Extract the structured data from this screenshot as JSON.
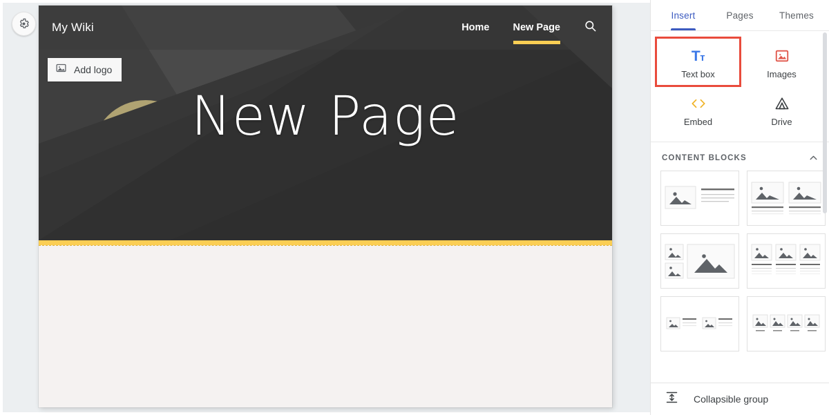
{
  "editor": {
    "settings_button": "settings-gear",
    "site": {
      "title": "My Wiki",
      "add_logo_label": "Add logo",
      "banner_heading": "New Page",
      "nav": [
        {
          "label": "Home",
          "active": false
        },
        {
          "label": "New Page",
          "active": true
        }
      ],
      "search_label": "Search",
      "accent_color": "#fbce54",
      "banner_bg": "#333333",
      "body_bg": "#f5f2f1"
    }
  },
  "panel": {
    "tabs": [
      {
        "label": "Insert",
        "active": true
      },
      {
        "label": "Pages",
        "active": false
      },
      {
        "label": "Themes",
        "active": false
      }
    ],
    "active_tab_color": "#3c5bc0",
    "highlight_color": "#e94b3c",
    "insert_items": [
      {
        "label": "Text box",
        "icon": "text-box-icon",
        "highlighted": true,
        "color": "#3b78e7"
      },
      {
        "label": "Images",
        "icon": "images-icon",
        "highlighted": false,
        "color": "#e0564a"
      },
      {
        "label": "Embed",
        "icon": "embed-code-icon",
        "highlighted": false,
        "color": "#f0b429"
      },
      {
        "label": "Drive",
        "icon": "google-drive-icon",
        "highlighted": false,
        "color": "#3c4043"
      }
    ],
    "content_blocks": {
      "title": "CONTENT BLOCKS",
      "collapsed": false,
      "items": [
        {
          "name": "image-left-text-right",
          "layout": "1-image-1-text"
        },
        {
          "name": "two-images-with-captions",
          "layout": "2-image-2-text"
        },
        {
          "name": "two-small-images-one-large",
          "layout": "stacked-2-plus-1"
        },
        {
          "name": "three-images-with-captions",
          "layout": "3-image-3-text"
        },
        {
          "name": "two-image-text-pairs-inline",
          "layout": "2-inline-pairs"
        },
        {
          "name": "four-images-with-captions",
          "layout": "4-image-4-text"
        }
      ]
    },
    "footer": {
      "label": "Collapsible group",
      "icon": "collapsible-group-icon"
    }
  }
}
